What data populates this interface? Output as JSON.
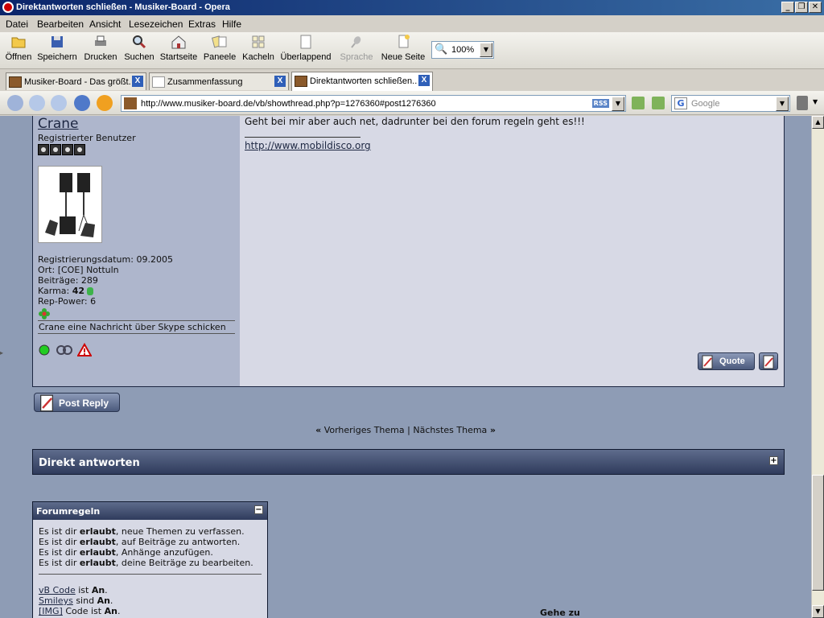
{
  "window": {
    "title": "Direktantworten schließen - Musiker-Board - Opera",
    "controls": [
      "_",
      "❐",
      "✕"
    ]
  },
  "menu": [
    "Datei",
    "Bearbeiten",
    "Ansicht",
    "Lesezeichen",
    "Extras",
    "Hilfe"
  ],
  "toolbar": {
    "buttons": [
      "Öffnen",
      "Speichern",
      "Drucken",
      "Suchen",
      "Startseite",
      "Paneele",
      "Kacheln",
      "Überlappend",
      "Sprache",
      "Neue Seite"
    ],
    "zoom": "100%"
  },
  "tabs": [
    {
      "label": "Musiker-Board - Das größt..."
    },
    {
      "label": "Zusammenfassung"
    },
    {
      "label": "Direktantworten schließen..."
    }
  ],
  "address": {
    "url": "http://www.musiker-board.de/vb/showthread.php?p=1276360#post1276360",
    "rss": "RSS",
    "search_engine": "Google",
    "search_letter": "G"
  },
  "post": {
    "username": "Crane",
    "user_title": "Registrierter Benutzer",
    "reg_date": "Registrierungsdatum: 09.2005",
    "location": "Ort: [COE] Nottuln",
    "posts": "Beiträge: 289",
    "karma_label": "Karma:",
    "karma_value": "42",
    "rep_power": "Rep-Power: 6",
    "skype": "Crane eine Nachricht über Skype schicken",
    "message": "Geht bei mir aber auch net, dadrunter bei den forum regeln geht es!!!",
    "signature_link": "http://www.mobildisco.org",
    "quote_label": "Quote"
  },
  "post_reply": "Post Reply",
  "thread_nav": {
    "prev_symbol": "«",
    "prev": "Vorheriges Thema",
    "separator": "|",
    "next": "Nächstes Thema",
    "next_symbol": "»"
  },
  "quick_reply": {
    "title": "Direkt antworten",
    "toggle": "+"
  },
  "forum_rules": {
    "title": "Forumregeln",
    "toggle": "−",
    "rules": [
      {
        "pre": "Es ist dir ",
        "bold": "erlaubt",
        "post": ", neue Themen zu verfassen."
      },
      {
        "pre": "Es ist dir ",
        "bold": "erlaubt",
        "post": ", auf Beiträge zu antworten."
      },
      {
        "pre": "Es ist dir ",
        "bold": "erlaubt",
        "post": ", Anhänge anzufügen."
      },
      {
        "pre": "Es ist dir ",
        "bold": "erlaubt",
        "post": ", deine Beiträge zu bearbeiten."
      }
    ],
    "codes": [
      {
        "link": "vB Code",
        "mid": " ist ",
        "state": "An",
        "end": "."
      },
      {
        "link": "Smileys",
        "mid": " sind ",
        "state": "An",
        "end": "."
      },
      {
        "link": "[IMG]",
        "mid": " Code ist ",
        "state": "An",
        "end": "."
      }
    ]
  },
  "goto_label": "Gehe zu"
}
